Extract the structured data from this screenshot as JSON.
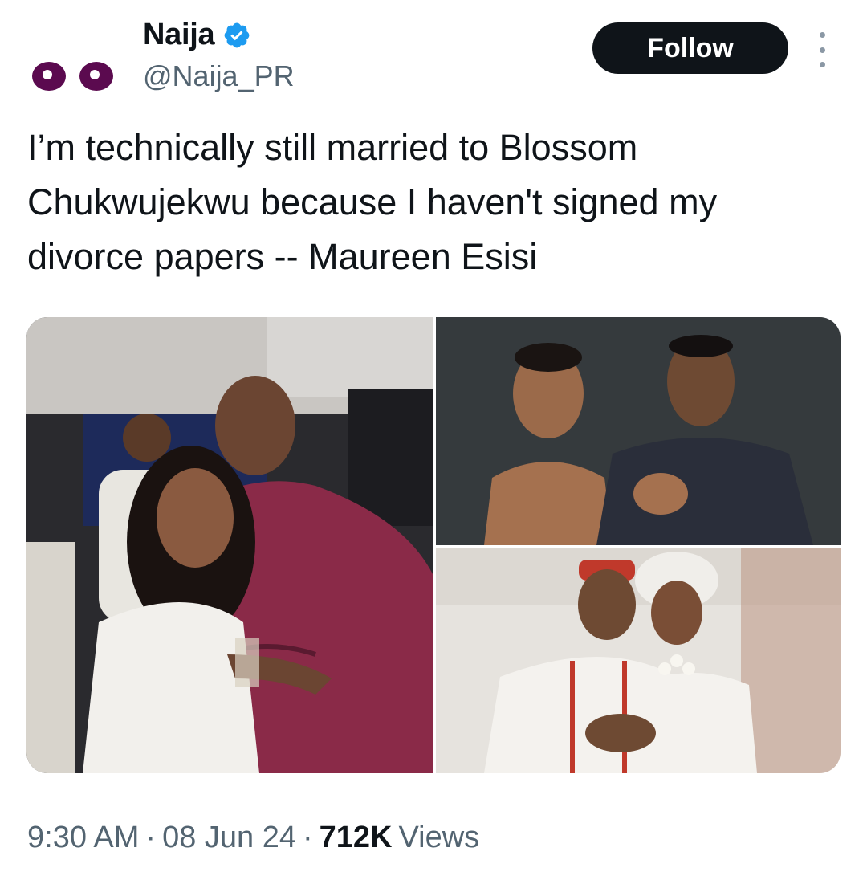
{
  "author": {
    "display_name": "Naija",
    "handle": "@Naija_PR",
    "verified": true,
    "avatar_icon": "eyes-icon",
    "verified_icon": "verified-badge-icon",
    "avatar_color": "#5b0a4f",
    "verified_color": "#1d9bf0"
  },
  "actions": {
    "follow_label": "Follow",
    "more_icon": "more-vertical-icon"
  },
  "tweet": {
    "text": "I’m technically still married to Blossom\nChukwujekwu because I haven't signed my\ndivorce papers -- Maureen Esisi"
  },
  "media": {
    "images": [
      {
        "description_icon": "photo-couple-party"
      },
      {
        "description_icon": "photo-couple-portrait"
      },
      {
        "description_icon": "photo-couple-wedding"
      }
    ]
  },
  "meta": {
    "time": "9:30 AM",
    "sep1": "·",
    "date": "08 Jun 24",
    "sep2": "·",
    "views_count": "712K",
    "views_label": "Views"
  },
  "colors": {
    "follow_bg": "#0f1419",
    "secondary_text": "#536471"
  }
}
